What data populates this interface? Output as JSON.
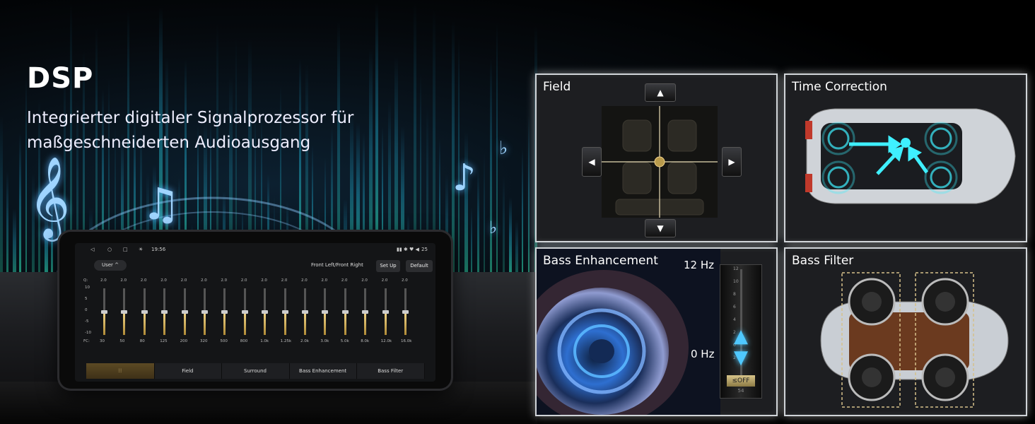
{
  "hero": {
    "title": "DSP",
    "subtitle": "Integrierter digitaler Signalprozessor für maßgeschneiderten Audioausgang"
  },
  "tablet": {
    "status": {
      "time": "19:56",
      "battery": "25"
    },
    "preset_label": "User",
    "channel_label": "Front Left/Front Right",
    "setup_button": "Set Up",
    "default_button": "Default",
    "q_label": "Q:",
    "fc_label": "FC:",
    "db_ticks": [
      "10",
      "5",
      "0",
      "-5",
      "-10"
    ],
    "q_values": [
      "2.0",
      "2.0",
      "2.0",
      "2.0",
      "2.0",
      "2.0",
      "2.0",
      "2.0",
      "2.0",
      "2.0",
      "2.0",
      "2.0",
      "2.0",
      "2.0",
      "2.0",
      "2.0"
    ],
    "frequencies": [
      "30",
      "50",
      "80",
      "125",
      "200",
      "320",
      "500",
      "800",
      "1.0k",
      "1.25k",
      "2.0k",
      "3.0k",
      "5.0k",
      "8.0k",
      "12.0k",
      "16.0k"
    ],
    "gains": [
      0,
      0,
      0,
      0,
      0,
      0,
      0,
      0,
      0,
      0,
      0,
      0,
      0,
      0,
      0,
      0
    ],
    "tabs": [
      "",
      "Field",
      "Surround",
      "Bass Enhancement",
      "Bass Filter"
    ],
    "active_tab_icon": "equalizer-icon"
  },
  "panels": {
    "field": {
      "title": "Field"
    },
    "time_correction": {
      "title": "Time Correction"
    },
    "bass_enhancement": {
      "title": "Bass Enhancement",
      "top_label": "12 Hz",
      "bottom_label": "0 Hz",
      "scale_ticks": [
        "12",
        "10",
        "8",
        "6",
        "4",
        "2",
        "0",
        "2"
      ],
      "off_label": "OFF",
      "value": "54"
    },
    "bass_filter": {
      "title": "Bass Filter"
    }
  },
  "colors": {
    "accent_gold": "#f3d38c",
    "highlight_cyan": "#3ff0ff",
    "panel_border": "#d0d4d8"
  }
}
